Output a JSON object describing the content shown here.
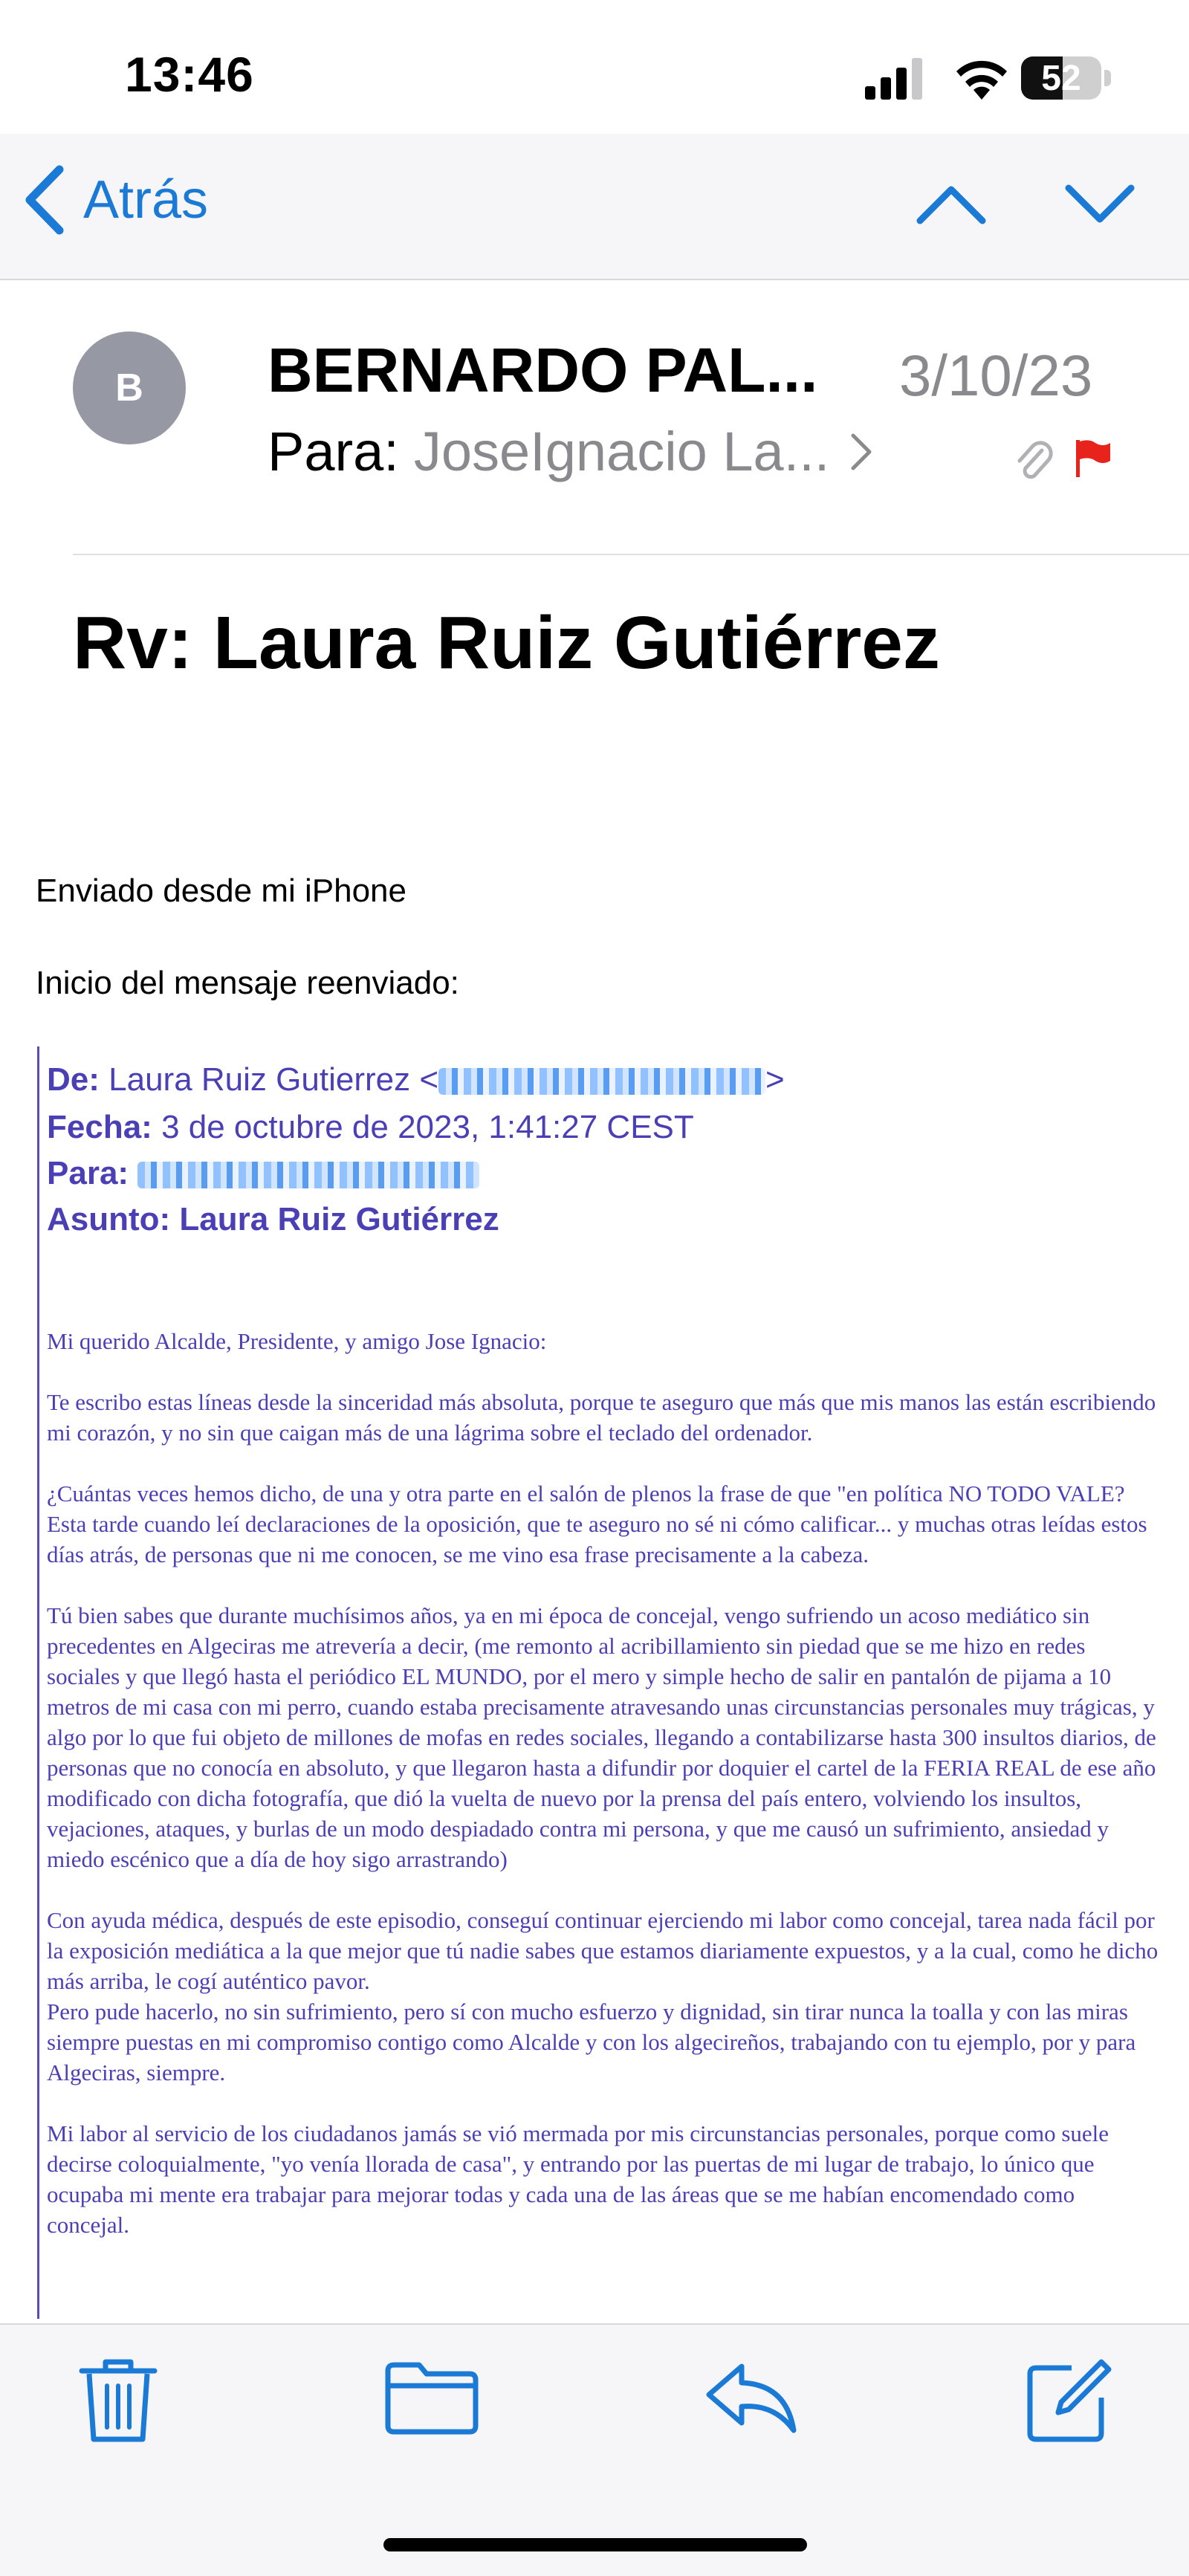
{
  "status_bar": {
    "time": "13:46",
    "battery": "52",
    "battery_level_percent": 52
  },
  "nav": {
    "back_label": "Atrás"
  },
  "header": {
    "avatar_initial": "B",
    "sender": "BERNARDO PAL...",
    "date": "3/10/23",
    "to_label": "Para:",
    "to_name": "JoseIgnacio La...",
    "subject": "Rv: Laura Ruiz Gutiérrez"
  },
  "body": {
    "sent_from": "Enviado desde mi iPhone",
    "forward_start": "Inicio del mensaje reenviado:",
    "forward": {
      "from_label": "De:",
      "from_value": "Laura Ruiz Gutierrez <",
      "from_end": ">",
      "date_label": "Fecha:",
      "date_value": "3 de octubre de 2023, 1:41:27 CEST",
      "to_label": "Para:",
      "subject_label": "Asunto:",
      "subject_value": "Laura Ruiz Gutiérrez"
    },
    "letter": [
      "Mi querido Alcalde, Presidente, y amigo Jose Ignacio:",
      "   Te escribo estas líneas desde la sinceridad más absoluta, porque te aseguro que más que mis manos las están escribiendo mi corazón, y no sin que caigan más de una lágrima sobre el teclado del ordenador.",
      "   ¿Cuántas veces hemos dicho, de una y otra parte en el salón de plenos la frase de que \"en política NO TODO VALE?",
      "   Esta tarde cuando leí declaraciones de la oposición, que te aseguro no sé ni cómo calificar... y muchas otras leídas estos días atrás, de personas que ni me conocen, se me vino esa frase precisamente a la cabeza.",
      "   Tú bien sabes que durante muchísimos años, ya en mi época de concejal, vengo sufriendo un acoso mediático sin precedentes en Algeciras me atrevería a decir, (me remonto al acribillamiento sin piedad que se me hizo en redes sociales y que llegó hasta el periódico EL MUNDO, por el mero y simple hecho de salir en pantalón de pijama a 10 metros de mi casa con mi perro, cuando estaba precisamente atravesando unas circunstancias personales muy trágicas, y algo por lo que fui objeto de millones de mofas en redes sociales, llegando a contabilizarse hasta 300 insultos diarios, de personas que no conocía en absoluto, y que llegaron hasta a difundir por doquier el cartel de la FERIA REAL de ese año modificado con dicha fotografía, que dió la vuelta de nuevo por la prensa del país entero, volviendo los insultos, vejaciones, ataques, y burlas de un modo despiadado contra mi persona, y que me causó un sufrimiento, ansiedad y miedo escénico que a día de hoy sigo arrastrando)",
      "   Con ayuda médica, después de este episodio, conseguí continuar ejerciendo mi labor como concejal, tarea nada fácil por la exposición mediática a la que mejor que tú nadie sabes que estamos diariamente expuestos, y a la cual, como he dicho más arriba, le cogí auténtico pavor.",
      "   Pero pude hacerlo, no sin sufrimiento, pero sí con mucho esfuerzo y dignidad, sin tirar nunca la toalla y con las miras siempre puestas en mi compromiso contigo como Alcalde y con los algecireños, trabajando con tu ejemplo, por y para Algeciras, siempre.",
      "   Mi labor al servicio de los ciudadanos jamás se vió mermada por mis circunstancias personales, porque como suele decirse coloquialmente, \"yo venía llorada de casa\", y entrando por las puertas de mi lugar de trabajo, lo único que ocupaba mi mente era trabajar para mejorar todas y cada una de las áreas que se me habían encomendado como concejal."
    ]
  },
  "colors": {
    "accent": "#1a7ad6",
    "quote": "#4b3fb6",
    "flag": "#e8231c",
    "gray": "#8a8a8e"
  }
}
